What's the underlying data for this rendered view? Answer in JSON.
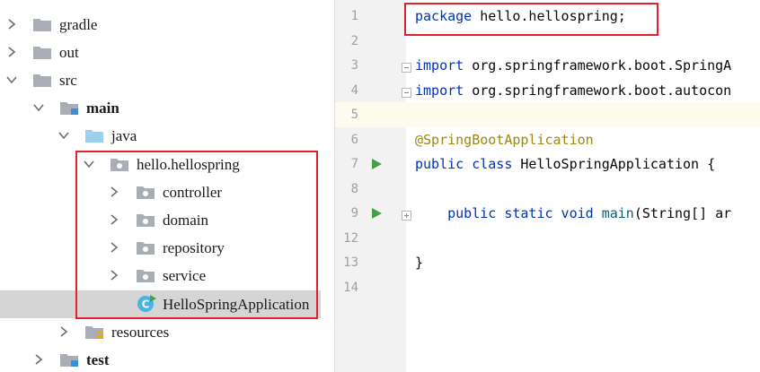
{
  "colors": {
    "highlight_box": "#e0202d",
    "folder_gray": "#a9aeb6",
    "source_folder_blue": "#9cd1ed",
    "run_green": "#43a047",
    "keyword": "#0033b3",
    "annotation": "#9e880d"
  },
  "tree": {
    "items": [
      {
        "label": "gradle",
        "expanded": false,
        "icon": "folder-icon"
      },
      {
        "label": "out",
        "expanded": false,
        "icon": "folder-icon"
      },
      {
        "label": "src",
        "expanded": true,
        "icon": "folder-icon"
      },
      {
        "label": "main",
        "expanded": true,
        "icon": "module-folder-icon"
      },
      {
        "label": "java",
        "expanded": true,
        "icon": "source-folder-icon"
      },
      {
        "label": "hello.hellospring",
        "expanded": true,
        "icon": "package-icon"
      },
      {
        "label": "controller",
        "expanded": false,
        "icon": "package-icon"
      },
      {
        "label": "domain",
        "expanded": false,
        "icon": "package-icon"
      },
      {
        "label": "repository",
        "expanded": false,
        "icon": "package-icon"
      },
      {
        "label": "service",
        "expanded": false,
        "icon": "package-icon"
      },
      {
        "label": "HelloSpringApplication",
        "selected": true,
        "icon": "spring-boot-class-icon"
      },
      {
        "label": "resources",
        "expanded": false,
        "icon": "resources-folder-icon"
      },
      {
        "label": "test",
        "expanded": false,
        "icon": "module-folder-icon"
      }
    ]
  },
  "editor": {
    "line_numbers": [
      "1",
      "2",
      "3",
      "4",
      "5",
      "6",
      "7",
      "8",
      "9",
      "12",
      "13",
      "14"
    ],
    "lines": {
      "l1_kw": "package",
      "l1_rest": " hello.hellospring;",
      "l3_kw": "import",
      "l3_rest": " org.springframework.boot.SpringA",
      "l4_kw": "import",
      "l4_rest": " org.springframework.boot.autocon",
      "l6_ann": "@SpringBootApplication",
      "l7_kw": "public class",
      "l7_rest": " HelloSpringApplication {",
      "l9_indent": "    ",
      "l9_kw": "public static void",
      "l9_space": " ",
      "l9_fn": "main",
      "l9_rest": "(String[] ar",
      "l13": "}"
    }
  }
}
